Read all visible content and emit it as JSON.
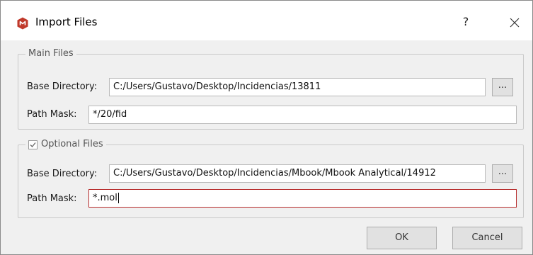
{
  "window": {
    "title": "Import Files",
    "help_label": "?",
    "brand_color": "#c0392b"
  },
  "main_files": {
    "legend": "Main Files",
    "base_directory_label": "Base Directory:",
    "base_directory_value": "C:/Users/Gustavo/Desktop/Incidencias/13811",
    "browse_label": "...",
    "path_mask_label": "Path Mask:",
    "path_mask_value": "*/20/fid"
  },
  "optional_files": {
    "legend": "Optional Files",
    "enabled": true,
    "base_directory_label": "Base Directory:",
    "base_directory_value": "C:/Users/Gustavo/Desktop/Incidencias/Mbook/Mbook Analytical/14912",
    "browse_label": "...",
    "path_mask_label": "Path Mask:",
    "path_mask_value": "*.mol"
  },
  "buttons": {
    "ok_label": "OK",
    "cancel_label": "Cancel"
  },
  "colors": {
    "active_border": "#b62b2b",
    "window_bg": "#f0f0f0"
  }
}
